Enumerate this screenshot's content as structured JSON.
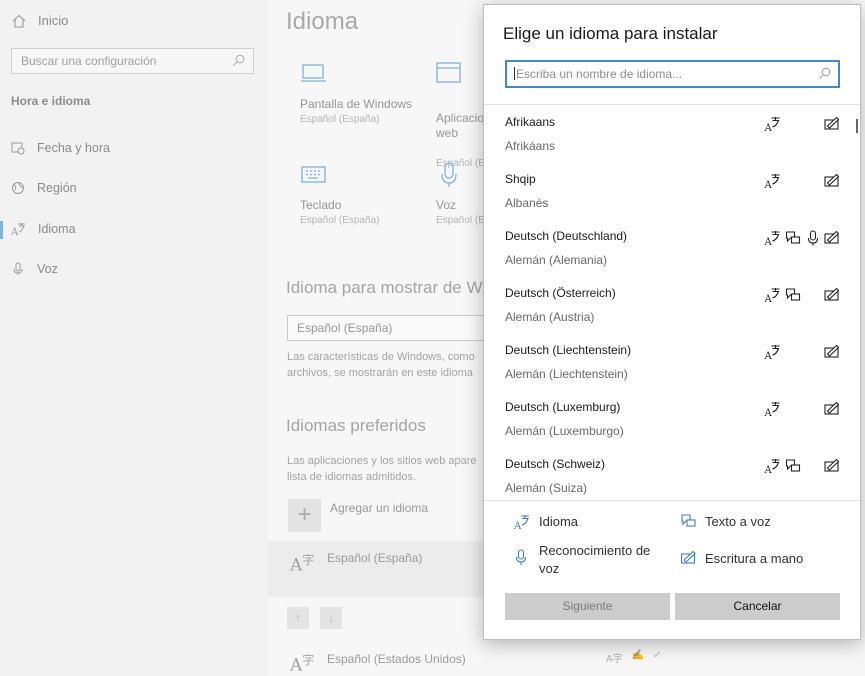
{
  "sidebar": {
    "home_label": "Inicio",
    "search_placeholder": "Buscar una configuración",
    "group_title": "Hora e idioma",
    "items": [
      {
        "label": "Fecha y hora",
        "icon": "calendar-clock-icon"
      },
      {
        "label": "Región",
        "icon": "globe-icon"
      },
      {
        "label": "Idioma",
        "icon": "language-icon"
      },
      {
        "label": "Voz",
        "icon": "microphone-icon"
      }
    ]
  },
  "main": {
    "title": "Idioma",
    "tiles": [
      {
        "label": "Pantalla de Windows",
        "sub": "Español (España)",
        "icon": "monitor-icon"
      },
      {
        "label": "Aplicacio\nweb",
        "sub": "Español (E",
        "icon": "app-window-icon"
      },
      {
        "label": "Teclado",
        "sub": "Español (España)",
        "icon": "keyboard-icon"
      },
      {
        "label": "Voz",
        "sub": "Español (E",
        "icon": "microphone-icon"
      }
    ],
    "display_lang_title": "Idioma para mostrar de Wi",
    "display_lang_value": "Español (España)",
    "display_lang_desc_1": "Las características de Windows, como",
    "display_lang_desc_2": "archivos, se mostrarán en este idioma",
    "preferred_title": "Idiomas preferidos",
    "preferred_desc_1": "Las aplicaciones y los sitios web apare",
    "preferred_desc_2": "lista de idiomas admitidos.",
    "add_language": "Agregar un idioma",
    "languages": [
      "Español (España)",
      "Español (Estados Unidos)"
    ],
    "up_arrow": "↑",
    "down_arrow": "↓"
  },
  "dialog": {
    "title": "Elige un idioma para instalar",
    "search_placeholder": "Escriba un nombre de idioma...",
    "languages": [
      {
        "name": "Afrikaans",
        "translation": "Afrikáans",
        "features": [
          "display",
          "handwriting"
        ]
      },
      {
        "name": "Shqip",
        "translation": "Albanés",
        "features": [
          "display",
          "handwriting"
        ]
      },
      {
        "name": "Deutsch (Deutschland)",
        "translation": "Alemán (Alemania)",
        "features": [
          "display",
          "tts",
          "speech",
          "handwriting"
        ]
      },
      {
        "name": "Deutsch (Österreich)",
        "translation": "Alemán (Austria)",
        "features": [
          "display",
          "tts",
          "handwriting"
        ]
      },
      {
        "name": "Deutsch (Liechtenstein)",
        "translation": "Alemán (Liechtenstein)",
        "features": [
          "display",
          "handwriting"
        ]
      },
      {
        "name": "Deutsch (Luxemburg)",
        "translation": "Alemán (Luxemburgo)",
        "features": [
          "display",
          "handwriting"
        ]
      },
      {
        "name": "Deutsch (Schweiz)",
        "translation": "Alemán (Suiza)",
        "features": [
          "display",
          "tts",
          "handwriting"
        ]
      }
    ],
    "legend": {
      "display": "Idioma",
      "tts": "Texto a voz",
      "speech_1": "Reconocimiento de",
      "speech_2": "voz",
      "handwriting": "Escritura a mano"
    },
    "next_button": "Siguiente",
    "cancel_button": "Cancelar"
  },
  "colors": {
    "accent": "#4a86c5",
    "legend_icon": "#3f7fc0",
    "button_bg": "#cccccc"
  }
}
